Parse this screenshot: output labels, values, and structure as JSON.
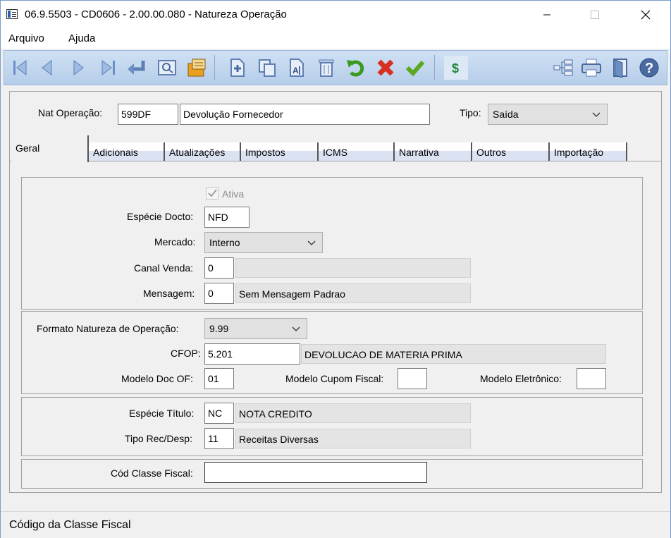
{
  "window": {
    "title": "06.9.5503 - CD0606 - 2.00.00.080 - Natureza Operação"
  },
  "menu": {
    "items": [
      "Arquivo",
      "Ajuda"
    ]
  },
  "toolbar": {
    "icons": [
      "first-record-icon",
      "previous-record-icon",
      "next-record-icon",
      "last-record-icon",
      "goto-icon",
      "search-icon",
      "list-icon",
      "new-icon",
      "copy-icon",
      "edit-icon",
      "delete-icon",
      "undo-icon",
      "cancel-icon",
      "confirm-icon",
      "dollar-icon",
      "tree-icon",
      "print-icon",
      "exit-icon",
      "help-icon"
    ],
    "dollar_symbol": "$"
  },
  "header": {
    "nat_label": "Nat Operação:",
    "nat_code": "599DF",
    "nat_desc": "Devolução Fornecedor",
    "tipo_label": "Tipo:",
    "tipo_value": "Saída"
  },
  "tabs": [
    "Geral",
    "Adicionais",
    "Atualizações",
    "Impostos",
    "ICMS",
    "Narrativa",
    "Outros",
    "Importação"
  ],
  "geral": {
    "ativa_label": "Ativa",
    "ativa_checked": true,
    "especie_label": "Espécie Docto:",
    "especie_value": "NFD",
    "mercado_label": "Mercado:",
    "mercado_value": "Interno",
    "canal_label": "Canal Venda:",
    "canal_value": "0",
    "canal_desc": "",
    "mensagem_label": "Mensagem:",
    "mensagem_value": "0",
    "mensagem_desc": "Sem Mensagem Padrao",
    "formato_label": "Formato Natureza de Operação:",
    "formato_value": "9.99",
    "cfop_label": "CFOP:",
    "cfop_value": "5.201",
    "cfop_desc": "DEVOLUCAO DE MATERIA PRIMA",
    "modelo_doc_label": "Modelo Doc OF:",
    "modelo_doc_value": "01",
    "modelo_cupom_label": "Modelo Cupom Fiscal:",
    "modelo_cupom_value": "",
    "modelo_eletronico_label": "Modelo Eletrônico:",
    "modelo_eletronico_value": "",
    "especie_titulo_label": "Espécie Título:",
    "especie_titulo_value": "NC",
    "especie_titulo_desc": "NOTA CREDITO",
    "tipo_rec_label": "Tipo Rec/Desp:",
    "tipo_rec_value": "11",
    "tipo_rec_desc": "Receitas Diversas",
    "classe_fiscal_label": "Cód Classe Fiscal:",
    "classe_fiscal_value": ""
  },
  "status": {
    "text": "Código da Classe Fiscal"
  }
}
